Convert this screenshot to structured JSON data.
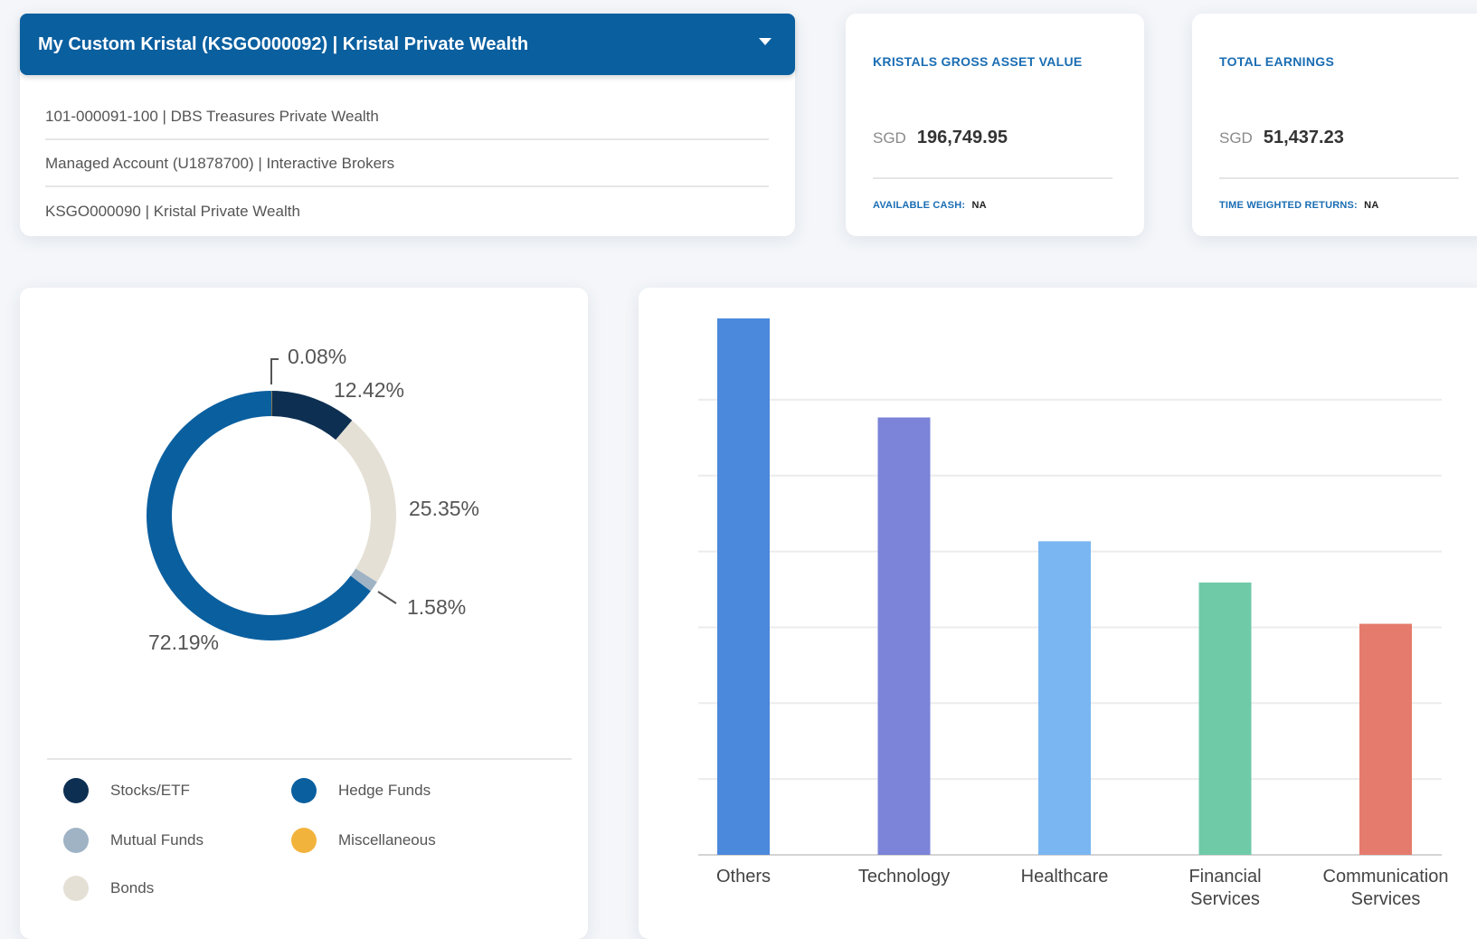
{
  "accounts": {
    "selected": "My Custom Kristal (KSGO000092) | Kristal Private Wealth",
    "options": [
      "101-000091-100 | DBS Treasures Private Wealth",
      "Managed Account (U1878700) | Interactive Brokers",
      "KSGO000090 | Kristal Private Wealth"
    ]
  },
  "gross_asset": {
    "label": "KRISTALS GROSS ASSET VALUE",
    "currency": "SGD",
    "amount": "196,749.95",
    "footer_label": "AVAILABLE CASH:",
    "footer_value": "NA"
  },
  "earnings": {
    "label": "TOTAL EARNINGS",
    "currency": "SGD",
    "amount": "51,437.23",
    "footer_label": "TIME WEIGHTED RETURNS:",
    "footer_value": "NA"
  },
  "legend": {
    "items": [
      {
        "label": "Stocks/ETF",
        "color": "#0d2f52"
      },
      {
        "label": "Hedge Funds",
        "color": "#0a5f9f"
      },
      {
        "label": "Mutual Funds",
        "color": "#9fb3c5"
      },
      {
        "label": "Miscellaneous",
        "color": "#f2b33d"
      },
      {
        "label": "Bonds",
        "color": "#e5e0d5"
      }
    ]
  },
  "chart_data": [
    {
      "type": "pie",
      "title": "",
      "slices": [
        {
          "label": "Miscellaneous",
          "value": 0.08,
          "display": "0.08%",
          "color": "#f2b33d"
        },
        {
          "label": "Stocks/ETF",
          "value": 12.42,
          "display": "12.42%",
          "color": "#0d2f52"
        },
        {
          "label": "Bonds",
          "value": 25.35,
          "display": "25.35%",
          "color": "#e5e0d5"
        },
        {
          "label": "Mutual Funds",
          "value": 1.58,
          "display": "1.58%",
          "color": "#9fb3c5"
        },
        {
          "label": "Hedge Funds",
          "value": 72.19,
          "display": "72.19%",
          "color": "#0a5f9f"
        }
      ]
    },
    {
      "type": "bar",
      "title": "",
      "xlabel": "",
      "ylabel": "",
      "categories": [
        "Others",
        "Technology",
        "Healthcare",
        "Financial Services",
        "Communication Services"
      ],
      "values": [
        6.5,
        5.3,
        3.8,
        3.3,
        2.8
      ],
      "colors": [
        "#4a89dc",
        "#7b84d8",
        "#7ab6f2",
        "#6fcaa8",
        "#e47b6d"
      ],
      "ylim": [
        0,
        6.5
      ],
      "grid": true
    }
  ]
}
